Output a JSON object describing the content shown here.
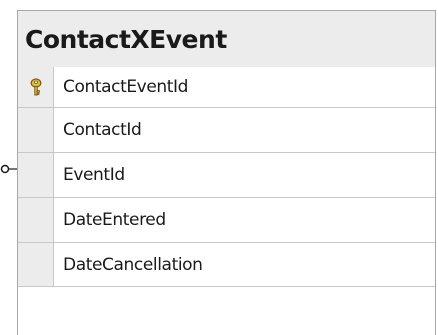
{
  "table": {
    "name": "ContactXEvent",
    "columns": [
      {
        "name": "ContactEventId",
        "primary_key": true
      },
      {
        "name": "ContactId",
        "primary_key": false
      },
      {
        "name": "EventId",
        "primary_key": false
      },
      {
        "name": "DateEntered",
        "primary_key": false
      },
      {
        "name": "DateCancellation",
        "primary_key": false
      }
    ]
  },
  "icons": {
    "primary_key": "key-icon",
    "relationship_end": "relationship-connector-icon"
  },
  "colors": {
    "header_bg": "#ececec",
    "border": "#a7a7a7",
    "key_yellow": "#e6c03a"
  }
}
